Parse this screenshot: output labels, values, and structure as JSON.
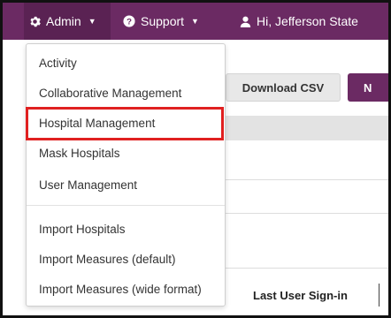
{
  "navbar": {
    "admin_label": "Admin",
    "support_label": "Support",
    "user_label": "Hi, Jefferson State",
    "bg_color": "#6b2a63"
  },
  "toolbar": {
    "download_csv": "Download CSV",
    "new_button_partial": "N"
  },
  "table": {
    "last_user_signin_header": "Last User Sign-in"
  },
  "admin_menu": {
    "items": [
      "Activity",
      "Collaborative Management",
      "Hospital Management",
      "Mask Hospitals",
      "User Management",
      "Import Hospitals",
      "Import Measures (default)",
      "Import Measures (wide format)"
    ],
    "highlighted_item": "Hospital Management"
  },
  "icons": {
    "admin": "gear-icon",
    "support": "help-circle-icon",
    "user": "user-icon"
  }
}
